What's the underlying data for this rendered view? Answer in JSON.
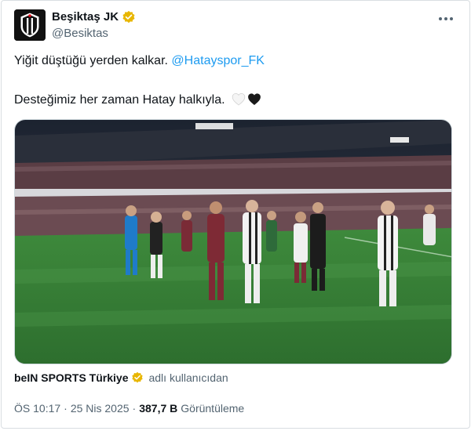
{
  "author": {
    "display_name": "Beşiktaş JK",
    "handle": "@Besiktas",
    "avatar_icon": "besiktas-crest-icon",
    "verified_color": "#e8b600"
  },
  "tweet": {
    "line1_text": "Yiğit düştüğü yerden kalkar.",
    "line1_mention": "@Hatayspor_FK",
    "line2_text": "Desteğimiz her zaman Hatay halkıyla.",
    "line2_emoji": [
      "white-heart-icon",
      "black-heart-icon"
    ],
    "mention_color": "#1d9bf0"
  },
  "media": {
    "type": "video",
    "description_icon": "stadium-video-thumbnail"
  },
  "source": {
    "name": "beIN SPORTS Türkiye",
    "suffix": "adlı kullanıcıdan"
  },
  "meta": {
    "time": "ÖS 10:17",
    "separator": "·",
    "date": "25 Nis 2025",
    "views_count": "387,7 B",
    "views_label": "Görüntüleme"
  }
}
